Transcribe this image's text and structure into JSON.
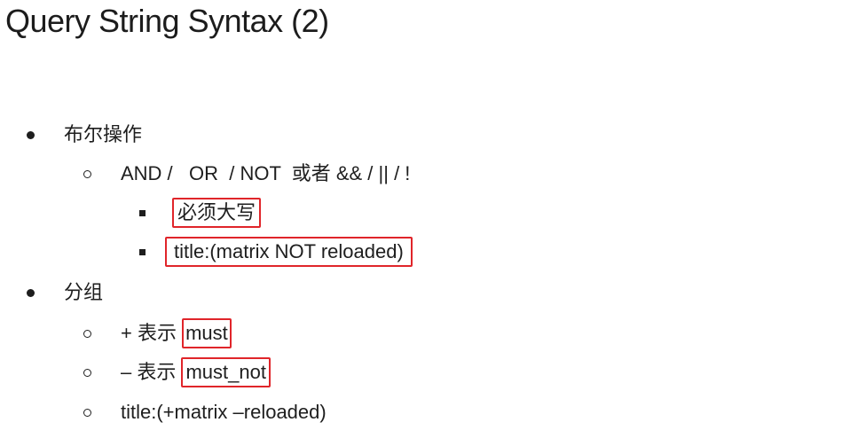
{
  "slide": {
    "title": "Query String Syntax (2)"
  },
  "items": {
    "boolean_ops": "布尔操作",
    "operators_line": "AND /   OR  / NOT  或者 && / || / !",
    "uppercase_note": "必须大写",
    "example_not": "title:(matrix NOT reloaded)",
    "grouping": "分组",
    "plus_prefix": "+ 表示",
    "plus_value": "must",
    "minus_prefix": "– 表示",
    "minus_value": "must_not",
    "example_group": "title:(+matrix –reloaded)"
  },
  "colors": {
    "highlight_box": "#e0252a",
    "text": "#1e1e1e",
    "background": "#ffffff"
  }
}
